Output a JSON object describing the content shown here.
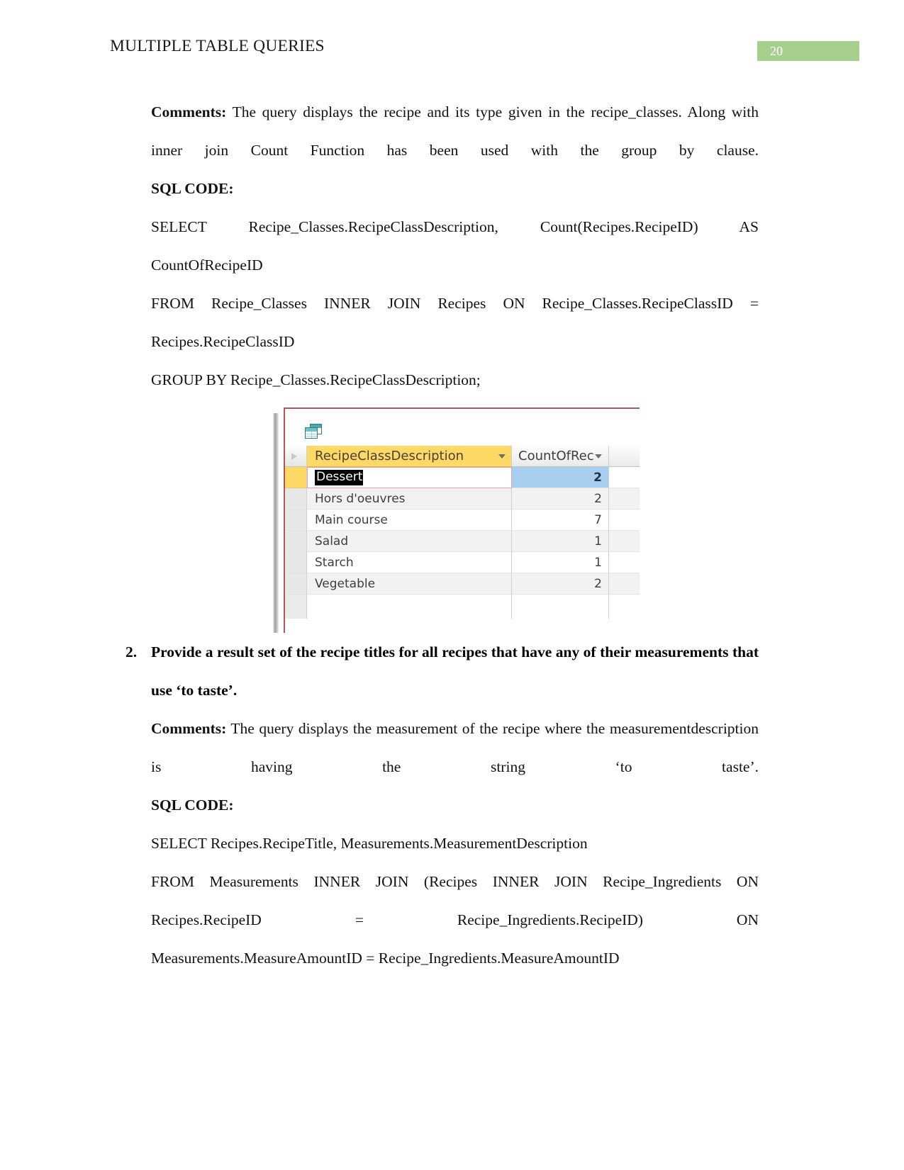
{
  "header": {
    "title": "MULTIPLE TABLE QUERIES",
    "page_number": "20",
    "badge_color": "#a9cf8f"
  },
  "document": {
    "comments_label_1": "Comments:",
    "comments_text_1": " The query displays the recipe and its type given in the recipe_classes. Along with inner join Count Function has been used with the group by clause.",
    "sql_code_label_1": "SQL CODE:",
    "sql_1_line_1": "SELECT Recipe_Classes.RecipeClassDescription, Count(Recipes.RecipeID) AS",
    "sql_1_line_2": "CountOfRecipeID",
    "sql_1_line_3": "FROM Recipe_Classes INNER JOIN Recipes ON Recipe_Classes.RecipeClassID =",
    "sql_1_line_4": "Recipes.RecipeClassID",
    "sql_1_line_5": "GROUP BY Recipe_Classes.RecipeClassDescription;",
    "item2_number": "2.",
    "item2_text": "Provide a result set of the recipe titles for all recipes that have any of their measurements that use ‘to taste’.",
    "comments_label_2": "Comments:",
    "comments_text_2": " The query displays the measurement of the recipe where the measurementdescription is having the string ‘to taste’.",
    "sql_code_label_2": "SQL CODE:",
    "sql_2_line_1": "SELECT Recipes.RecipeTitle, Measurements.MeasurementDescription",
    "sql_2_line_2": "FROM Measurements INNER JOIN (Recipes INNER JOIN Recipe_Ingredients ON",
    "sql_2_line_3": "Recipes.RecipeID = Recipe_Ingredients.RecipeID) ON",
    "sql_2_line_4": "Measurements.MeasureAmountID = Recipe_Ingredients.MeasureAmountID"
  },
  "datasheet": {
    "icon": "datasheet-icon",
    "columns": [
      {
        "key": "desc",
        "label": "RecipeClassDescription",
        "sort_icon": "chevron-down-icon"
      },
      {
        "key": "count",
        "label": "CountOfRec",
        "sort_icon": "chevron-down-icon"
      }
    ],
    "rows": [
      {
        "desc": "Dessert",
        "count": "2",
        "selected": true
      },
      {
        "desc": "Hors d'oeuvres",
        "count": "2",
        "selected": false
      },
      {
        "desc": "Main course",
        "count": "7",
        "selected": false
      },
      {
        "desc": "Salad",
        "count": "1",
        "selected": false
      },
      {
        "desc": "Starch",
        "count": "1",
        "selected": false
      },
      {
        "desc": "Vegetable",
        "count": "2",
        "selected": false
      }
    ],
    "colors": {
      "header_active": "#ffd966",
      "selected_value": "#a8cff0",
      "frame_border": "#b5565a"
    }
  }
}
